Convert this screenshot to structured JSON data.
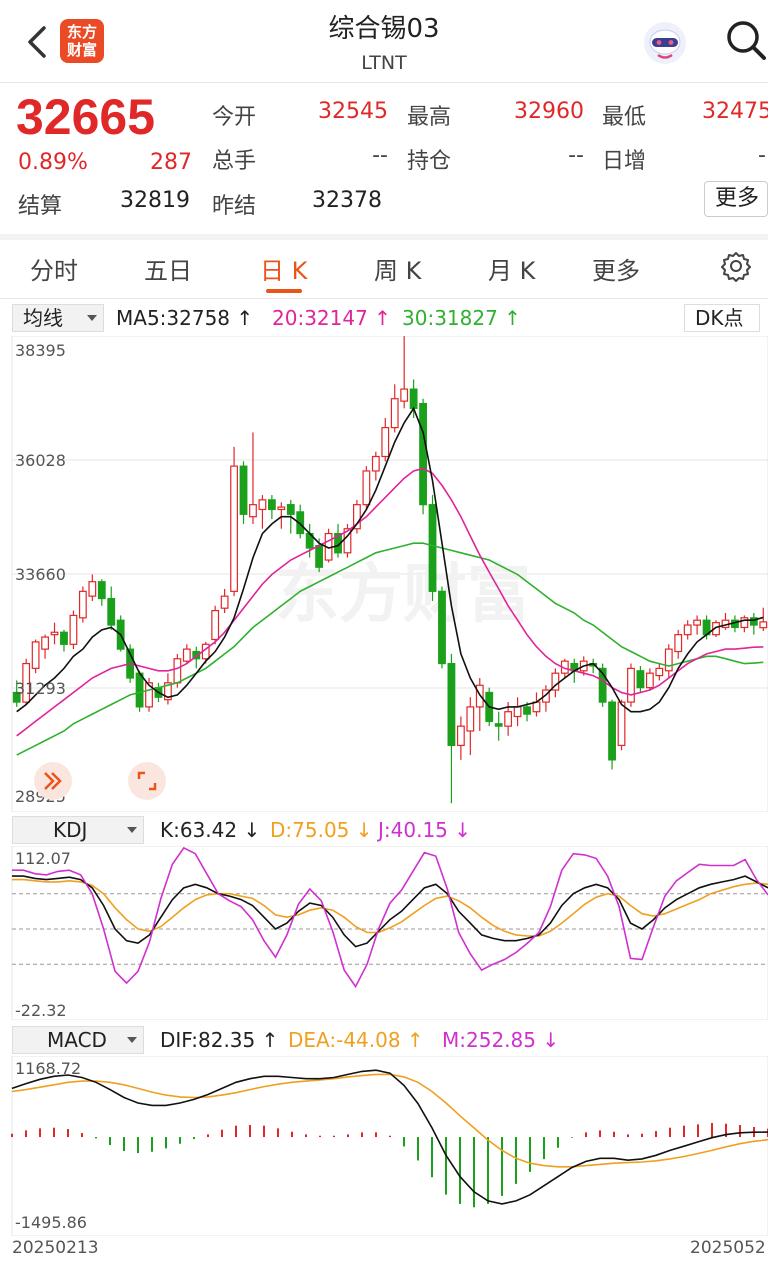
{
  "header": {
    "back_icon": "chevron-left-icon",
    "logo_text": [
      "东方",
      "财富"
    ],
    "title": "综合锡03",
    "subtitle": "LTNT",
    "avatar_icon": "robot-avatar-icon",
    "search_icon": "search-icon"
  },
  "quote": {
    "price": "32665",
    "change_pct": "0.89%",
    "change": "287",
    "settle_label": "结算",
    "settle": "32819",
    "fields": [
      {
        "label": "今开",
        "value": "32545"
      },
      {
        "label": "最高",
        "value": "32960"
      },
      {
        "label": "最低",
        "value": "32475"
      },
      {
        "label": "总手",
        "value": "--"
      },
      {
        "label": "持仓",
        "value": "--"
      },
      {
        "label": "日增",
        "value": "-"
      },
      {
        "label": "昨结",
        "value": "32378"
      }
    ],
    "more_label": "更多"
  },
  "tabs": [
    "分时",
    "五日",
    "日 K",
    "周 K",
    "月 K",
    "更多"
  ],
  "active_tab": "日 K",
  "settings_icon": "gear-icon",
  "ma_bar": {
    "select": "均线",
    "ma5": "MA5:32758 ↑",
    "ma20": "20:32147 ↑",
    "ma30": "30:31827 ↑",
    "dk_label": "DK点"
  },
  "kdj_bar": {
    "select": "KDJ",
    "k": "K:63.42 ↓",
    "d": "D:75.05 ↓",
    "j": "J:40.15 ↓"
  },
  "macd_bar": {
    "select": "MACD",
    "dif": "DIF:82.35 ↑",
    "dea": "DEA:-44.08 ↑",
    "m": "M:252.85 ↓"
  },
  "colors": {
    "up": "#e02828",
    "down": "#1aa01a",
    "ma5": "#111111",
    "ma20": "#e0249a",
    "ma30": "#2fb02f",
    "k": "#111111",
    "d": "#f0a020",
    "j": "#d030d0"
  },
  "chart_data": [
    {
      "type": "candlestick",
      "y_ticks": [
        "38395",
        "36028",
        "33660",
        "31293",
        "28925"
      ],
      "ylim": [
        28925,
        38395
      ],
      "x_tick_labels": [
        "20250213",
        "2025052"
      ],
      "candles": [
        [
          31200,
          31000,
          31450,
          30900
        ],
        [
          31000,
          31800,
          31900,
          30950
        ],
        [
          31700,
          32250,
          32300,
          31600
        ],
        [
          32100,
          32350,
          32400,
          31900
        ],
        [
          32400,
          32450,
          32650,
          32200
        ],
        [
          32450,
          32200,
          32500,
          32050
        ],
        [
          32200,
          32800,
          32900,
          32100
        ],
        [
          32750,
          33300,
          33400,
          32650
        ],
        [
          33200,
          33500,
          33650,
          33100
        ],
        [
          33500,
          33150,
          33550,
          33000
        ],
        [
          33150,
          32600,
          33400,
          32500
        ],
        [
          32700,
          32100,
          32800,
          32050
        ],
        [
          32100,
          31500,
          32200,
          31400
        ],
        [
          31600,
          30900,
          31650,
          30800
        ],
        [
          30900,
          31400,
          31500,
          30800
        ],
        [
          31300,
          31100,
          31400,
          31000
        ],
        [
          31050,
          31400,
          31600,
          30950
        ],
        [
          31400,
          31900,
          32000,
          31300
        ],
        [
          31850,
          32100,
          32200,
          31800
        ],
        [
          32050,
          31900,
          32150,
          31700
        ],
        [
          31900,
          32200,
          32250,
          31800
        ],
        [
          32300,
          32900,
          33000,
          32200
        ],
        [
          32950,
          33200,
          33350,
          32850
        ],
        [
          33300,
          35900,
          36300,
          33200
        ],
        [
          35900,
          34900,
          36000,
          34700
        ],
        [
          34850,
          35100,
          36600,
          34700
        ],
        [
          35000,
          35200,
          35300,
          34600
        ],
        [
          35200,
          35000,
          35300,
          34800
        ],
        [
          35000,
          35050,
          35150,
          34600
        ],
        [
          35100,
          34900,
          35200,
          34500
        ],
        [
          34950,
          34500,
          35100,
          34400
        ],
        [
          34500,
          34200,
          34700,
          34000
        ],
        [
          34250,
          33800,
          34400,
          33700
        ],
        [
          33950,
          34500,
          34600,
          33900
        ],
        [
          34500,
          34100,
          34700,
          34000
        ],
        [
          34100,
          34600,
          34700,
          34000
        ],
        [
          34600,
          35100,
          35200,
          34500
        ],
        [
          35100,
          35800,
          35900,
          35000
        ],
        [
          35800,
          36100,
          36200,
          35600
        ],
        [
          36100,
          36700,
          36900,
          36000
        ],
        [
          36700,
          37300,
          37600,
          36600
        ],
        [
          37250,
          37500,
          38600,
          37100
        ],
        [
          37500,
          37100,
          37700,
          36900
        ],
        [
          37200,
          35100,
          37300,
          34900
        ],
        [
          35100,
          33300,
          35300,
          33100
        ],
        [
          33300,
          31800,
          33400,
          31700
        ],
        [
          31800,
          30100,
          32000,
          28900
        ],
        [
          30100,
          30500,
          30700,
          29800
        ],
        [
          30400,
          30900,
          31100,
          29900
        ],
        [
          30900,
          31350,
          31500,
          30400
        ],
        [
          31200,
          30600,
          31300,
          30500
        ],
        [
          30550,
          30500,
          30800,
          30200
        ],
        [
          30500,
          30800,
          31000,
          30300
        ],
        [
          30700,
          30900,
          31100,
          30500
        ],
        [
          30900,
          30750,
          31000,
          30600
        ],
        [
          30800,
          31000,
          31200,
          30700
        ],
        [
          31000,
          31250,
          31350,
          30800
        ],
        [
          31250,
          31600,
          31700,
          31100
        ],
        [
          31600,
          31850,
          31900,
          31500
        ],
        [
          31800,
          31650,
          31900,
          31400
        ],
        [
          31650,
          31850,
          31950,
          31550
        ],
        [
          31800,
          31750,
          31900,
          31600
        ],
        [
          31700,
          31000,
          31800,
          30900
        ],
        [
          31000,
          29800,
          31050,
          29600
        ],
        [
          30100,
          31000,
          31050,
          30000
        ],
        [
          31000,
          31700,
          31800,
          30900
        ],
        [
          31650,
          31300,
          31750,
          31200
        ],
        [
          31300,
          31600,
          31700,
          31250
        ],
        [
          31550,
          31700,
          31800,
          31450
        ],
        [
          31650,
          32100,
          32200,
          31500
        ],
        [
          32050,
          32400,
          32500,
          31900
        ],
        [
          32400,
          32600,
          32700,
          32300
        ],
        [
          32600,
          32700,
          32800,
          32400
        ],
        [
          32700,
          32400,
          32800,
          32300
        ],
        [
          32400,
          32650,
          32700,
          32350
        ],
        [
          32550,
          32700,
          32850,
          32500
        ],
        [
          32700,
          32550,
          32800,
          32450
        ],
        [
          32550,
          32750,
          32800,
          32450
        ],
        [
          32750,
          32600,
          32850,
          32400
        ],
        [
          32545,
          32665,
          32960,
          32475
        ]
      ],
      "ma5": [
        30800,
        30950,
        31150,
        31350,
        31500,
        31700,
        31950,
        32100,
        32350,
        32500,
        32550,
        32400,
        32000,
        31600,
        31350,
        31200,
        31100,
        31150,
        31350,
        31600,
        31850,
        32050,
        32350,
        32750,
        33350,
        34000,
        34500,
        34700,
        34850,
        34850,
        34700,
        34500,
        34300,
        34200,
        34250,
        34450,
        34700,
        35000,
        35400,
        35900,
        36400,
        36800,
        37100,
        36600,
        35600,
        34300,
        33000,
        32000,
        31500,
        31150,
        30900,
        30850,
        30900,
        30900,
        30950,
        31000,
        31150,
        31350,
        31500,
        31650,
        31750,
        31800,
        31600,
        31300,
        30950,
        30800,
        30800,
        30850,
        31000,
        31300,
        31700,
        32000,
        32250,
        32400,
        32550,
        32600,
        32650,
        32700,
        32700,
        32758
      ],
      "ma20": [
        30300,
        30450,
        30600,
        30750,
        30900,
        31050,
        31200,
        31350,
        31500,
        31600,
        31700,
        31750,
        31800,
        31750,
        31700,
        31650,
        31650,
        31700,
        31800,
        31950,
        32100,
        32250,
        32450,
        32700,
        32950,
        33200,
        33450,
        33650,
        33800,
        33950,
        34050,
        34150,
        34250,
        34350,
        34450,
        34550,
        34700,
        34850,
        35050,
        35250,
        35450,
        35650,
        35800,
        35850,
        35750,
        35500,
        35200,
        34850,
        34450,
        34050,
        33700,
        33350,
        33000,
        32700,
        32400,
        32150,
        31950,
        31800,
        31700,
        31650,
        31600,
        31550,
        31450,
        31300,
        31200,
        31150,
        31200,
        31250,
        31350,
        31500,
        31650,
        31800,
        31900,
        32000,
        32050,
        32100,
        32100,
        32120,
        32140,
        32147
      ],
      "ma30": [
        29900,
        30000,
        30100,
        30200,
        30300,
        30400,
        30550,
        30650,
        30750,
        30850,
        30950,
        31050,
        31150,
        31200,
        31250,
        31300,
        31350,
        31400,
        31500,
        31600,
        31700,
        31850,
        32000,
        32150,
        32350,
        32550,
        32700,
        32850,
        33000,
        33150,
        33300,
        33400,
        33500,
        33600,
        33700,
        33800,
        33900,
        34000,
        34100,
        34150,
        34200,
        34250,
        34300,
        34300,
        34250,
        34200,
        34150,
        34100,
        34050,
        34000,
        33950,
        33850,
        33750,
        33650,
        33500,
        33350,
        33200,
        33050,
        32950,
        32850,
        32700,
        32600,
        32450,
        32300,
        32150,
        32050,
        31950,
        31850,
        31800,
        31750,
        31800,
        31850,
        31900,
        31950,
        31950,
        31900,
        31850,
        31800,
        31810,
        31827
      ],
      "kdj": {
        "ylim": [
          -22.32,
          112.07
        ],
        "k": [
          95,
          95,
          93,
          92,
          93,
          94,
          92,
          85,
          70,
          50,
          40,
          38,
          45,
          60,
          75,
          85,
          88,
          85,
          80,
          78,
          75,
          70,
          60,
          50,
          55,
          65,
          72,
          70,
          60,
          45,
          35,
          38,
          48,
          58,
          65,
          75,
          85,
          88,
          80,
          65,
          55,
          45,
          42,
          40,
          40,
          42,
          45,
          55,
          70,
          80,
          85,
          88,
          85,
          75,
          55,
          50,
          58,
          68,
          75,
          80,
          85,
          88,
          90,
          92,
          95,
          90,
          85
        ],
        "d": [
          92,
          92,
          91,
          90,
          90,
          91,
          90,
          87,
          80,
          68,
          58,
          50,
          48,
          52,
          60,
          68,
          75,
          79,
          80,
          80,
          78,
          76,
          70,
          62,
          60,
          62,
          66,
          68,
          66,
          60,
          52,
          47,
          47,
          51,
          56,
          63,
          70,
          76,
          78,
          74,
          68,
          60,
          53,
          48,
          45,
          44,
          44,
          48,
          55,
          63,
          71,
          77,
          80,
          78,
          70,
          63,
          61,
          63,
          67,
          71,
          75,
          80,
          83,
          86,
          88,
          89,
          88
        ],
        "j": [
          100,
          100,
          97,
          96,
          99,
          100,
          96,
          80,
          50,
          14,
          4,
          14,
          39,
          76,
          105,
          119,
          114,
          97,
          80,
          74,
          69,
          58,
          40,
          26,
          45,
          71,
          84,
          74,
          48,
          15,
          1,
          20,
          50,
          72,
          83,
          99,
          115,
          112,
          84,
          47,
          29,
          15,
          20,
          24,
          30,
          38,
          47,
          69,
          100,
          114,
          113,
          110,
          95,
          69,
          25,
          24,
          52,
          78,
          91,
          98,
          105,
          104,
          104,
          104,
          109,
          92,
          79
        ]
      },
      "macd": {
        "ylim": [
          -1495.86,
          1168.72
        ],
        "dif": [
          800,
          880,
          950,
          1000,
          1020,
          980,
          900,
          780,
          650,
          560,
          520,
          520,
          560,
          620,
          700,
          800,
          900,
          960,
          1000,
          1000,
          980,
          960,
          960,
          980,
          1030,
          1080,
          1100,
          1050,
          850,
          550,
          150,
          -300,
          -650,
          -900,
          -1050,
          -1100,
          -1050,
          -950,
          -800,
          -650,
          -500,
          -400,
          -350,
          -350,
          -380,
          -360,
          -300,
          -220,
          -150,
          -80,
          -10,
          40,
          70,
          80,
          82
        ],
        "dea": [
          750,
          780,
          820,
          860,
          900,
          920,
          920,
          900,
          860,
          800,
          740,
          690,
          660,
          650,
          660,
          690,
          730,
          780,
          830,
          870,
          900,
          920,
          940,
          960,
          990,
          1010,
          1030,
          1030,
          990,
          900,
          750,
          560,
          350,
          150,
          -50,
          -220,
          -350,
          -430,
          -470,
          -490,
          -490,
          -470,
          -450,
          -430,
          -420,
          -410,
          -390,
          -360,
          -320,
          -270,
          -220,
          -160,
          -110,
          -70,
          -44
        ]
      }
    }
  ]
}
